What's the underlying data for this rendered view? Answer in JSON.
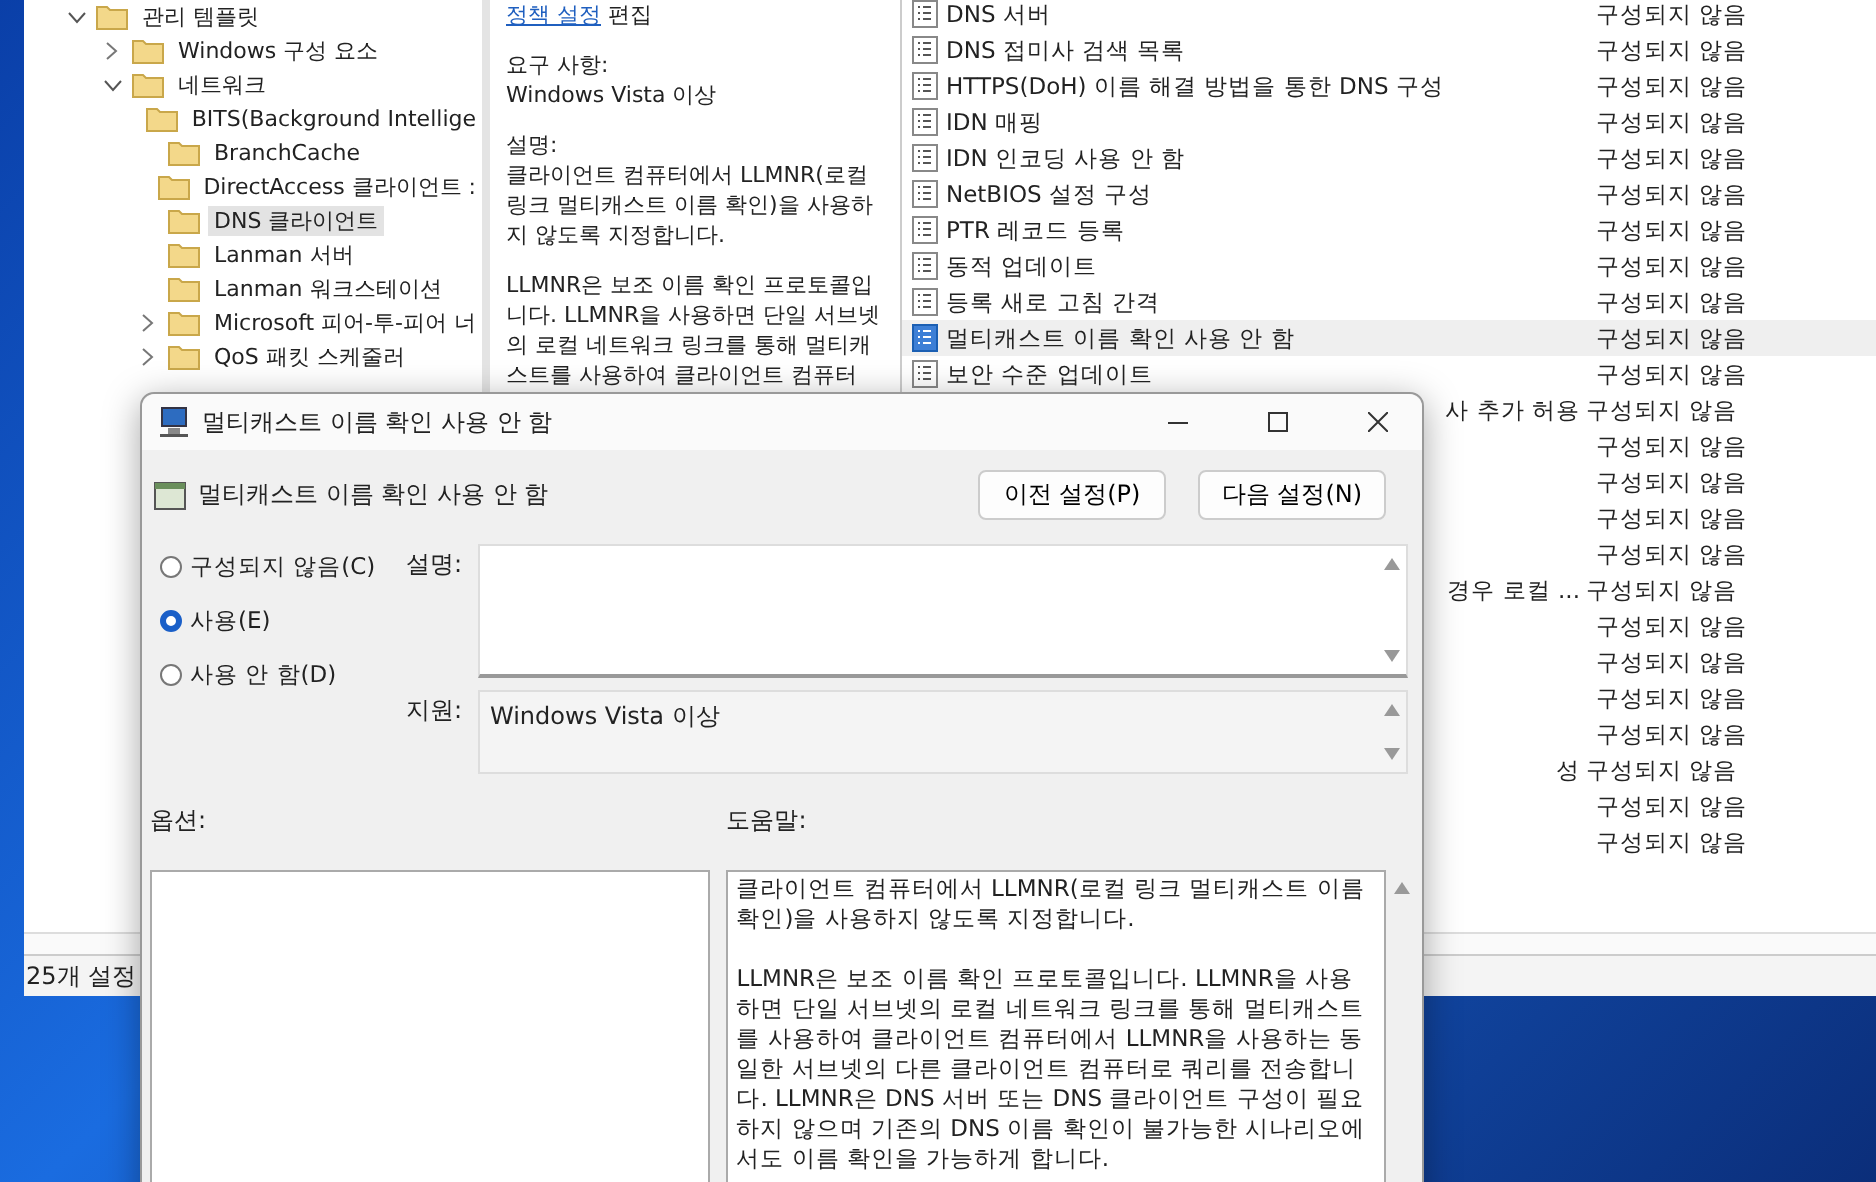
{
  "tree": [
    {
      "label": "관리 템플릿",
      "expanded": true,
      "selected": false,
      "children": [
        {
          "label": "Windows 구성 요소",
          "expanded": false,
          "selected": false
        },
        {
          "label": "네트워크",
          "expanded": true,
          "selected": false,
          "children": [
            {
              "label": "BITS(Background Intellige",
              "selected": false
            },
            {
              "label": "BranchCache",
              "selected": false
            },
            {
              "label": "DirectAccess 클라이언트 :",
              "selected": false
            },
            {
              "label": "DNS 클라이언트",
              "selected": true
            },
            {
              "label": "Lanman 서버",
              "selected": false
            },
            {
              "label": "Lanman 워크스테이션",
              "selected": false
            },
            {
              "label": "Microsoft 피어-투-피어 너",
              "expanded": false,
              "selected": false
            },
            {
              "label": "QoS 패킷 스케줄러",
              "expanded": false,
              "selected": false
            }
          ]
        }
      ]
    }
  ],
  "description": {
    "link": "정책 설정",
    "link_suffix": "편집",
    "paragraphs": [
      "요구 사항:\nWindows Vista 이상",
      "설명:\n클라이언트 컴퓨터에서 LLMNR(로컬 링크 멀티캐스트 이름 확인)을 사용하지 않도록 지정합니다.",
      "LLMNR은 보조 이름 확인 프로토콜입니다. LLMNR을 사용하면 단일 서브넷의 로컬 네트워크 링크를 통해 멀티캐스트를 사용하여 클라이언트 컴퓨터"
    ]
  },
  "list": {
    "rows": [
      {
        "name": "DNS 서버",
        "status": "구성되지 않음",
        "selected": false
      },
      {
        "name": "DNS 접미사 검색 목록",
        "status": "구성되지 않음",
        "selected": false
      },
      {
        "name": "HTTPS(DoH) 이름 해결 방법을 통한 DNS 구성",
        "status": "구성되지 않음",
        "selected": false
      },
      {
        "name": "IDN 매핑",
        "status": "구성되지 않음",
        "selected": false
      },
      {
        "name": "IDN 인코딩 사용 안 함",
        "status": "구성되지 않음",
        "selected": false
      },
      {
        "name": "NetBIOS 설정 구성",
        "status": "구성되지 않음",
        "selected": false
      },
      {
        "name": "PTR 레코드 등록",
        "status": "구성되지 않음",
        "selected": false
      },
      {
        "name": "동적 업데이트",
        "status": "구성되지 않음",
        "selected": false
      },
      {
        "name": "등록 새로 고침 간격",
        "status": "구성되지 않음",
        "selected": false
      },
      {
        "name": "멀티캐스트 이름 확인 사용 안 함",
        "status": "구성되지 않음",
        "selected": true
      },
      {
        "name": "보안 수준 업데이트",
        "status": "구성되지 않음",
        "selected": false
      },
      {
        "name": "사 추가 허용",
        "kind": "clipped",
        "status": "구성되지 않음",
        "selected": false
      },
      {
        "status": "구성되지 않음",
        "selected": false
      },
      {
        "status": "구성되지 않음",
        "selected": false
      },
      {
        "status": "구성되지 않음",
        "selected": false
      },
      {
        "status": "구성되지 않음",
        "selected": false
      },
      {
        "name": "경우 로컬 ...",
        "kind": "clipped",
        "status": "구성되지 않음",
        "selected": false
      },
      {
        "status": "구성되지 않음",
        "selected": false
      },
      {
        "status": "구성되지 않음",
        "selected": false
      },
      {
        "status": "구성되지 않음",
        "selected": false
      },
      {
        "status": "구성되지 않음",
        "selected": false
      },
      {
        "name": "성",
        "kind": "clipped",
        "status": "구성되지 않음",
        "selected": false
      },
      {
        "status": "구성되지 않음",
        "selected": false
      },
      {
        "status": "구성되지 않음",
        "selected": false
      }
    ]
  },
  "status_bar": {
    "text": "25개 설정"
  },
  "dialog": {
    "title": "멀티캐스트 이름 확인 사용 안 함",
    "policy_name": "멀티캐스트 이름 확인 사용 안 함",
    "buttons": [
      "이전 설정(P)",
      "다음 설정(N)"
    ],
    "radios": [
      {
        "label": "구성되지 않음(C)",
        "selected": false
      },
      {
        "label": "사용(E)",
        "selected": true
      },
      {
        "label": "사용 안 함(D)",
        "selected": false
      }
    ],
    "comment_label": "설명:",
    "supported_label": "지원:",
    "supported_value": "Windows Vista 이상",
    "options_label": "옵션:",
    "help_label": "도움말:",
    "help_paragraphs": [
      "클라이언트 컴퓨터에서 LLMNR(로컬 링크 멀티캐스트 이름 확인)을 사용하지 않도록 지정합니다.",
      "LLMNR은 보조 이름 확인 프로토콜입니다. LLMNR을 사용하면 단일 서브넷의 로컬 네트워크 링크를 통해 멀티캐스트를 사용하여 클라이언트 컴퓨터에서 LLMNR을 사용하는 동일한 서브넷의 다른 클라이언트 컴퓨터로 쿼리를 전송합니다. LLMNR은 DNS 서버 또는 DNS 클라이언트 구성이 필요하지 않으며 기존의 DNS 이름 확인이 불가능한 시나리오에서도 이름 확인을 가능하게 합니다."
    ]
  }
}
